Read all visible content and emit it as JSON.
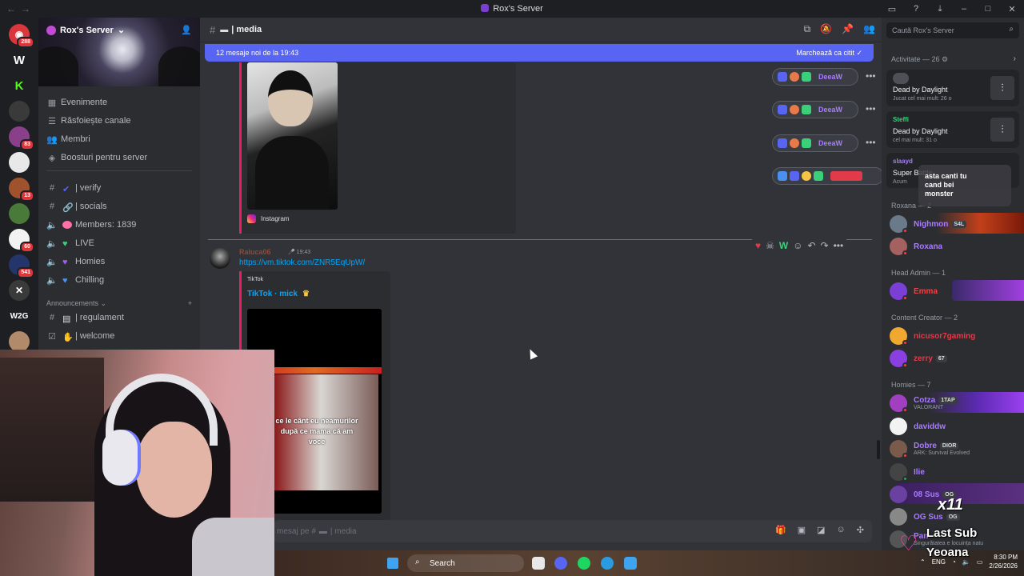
{
  "window": {
    "title": "Rox's Server"
  },
  "rail": {
    "badges": [
      "288",
      "83",
      "13",
      "60",
      "541"
    ]
  },
  "sidebar": {
    "server_name": "Rox's Server",
    "items": [
      {
        "label": "Evenimente"
      },
      {
        "label": "Răsfoiește canale"
      },
      {
        "label": "Membri"
      },
      {
        "label": "Boosturi pentru server"
      }
    ],
    "channels": [
      {
        "label": "| verify"
      },
      {
        "label": "| socials"
      },
      {
        "label": "Members: 1839"
      },
      {
        "label": "LIVE"
      },
      {
        "label": "Homies"
      },
      {
        "label": "Chilling"
      }
    ],
    "category": "Announcements",
    "announce_channels": [
      {
        "label": "| regulament"
      },
      {
        "label": "| welcome"
      }
    ]
  },
  "chat": {
    "channel_name": "| media",
    "new_messages_text": "12 mesaje noi de la 19:43",
    "mark_read": "Marchează ca citit",
    "embed1": {
      "source": "Instagram"
    },
    "reactions": [
      {
        "name": "DeeaW"
      },
      {
        "name": "DeeaW"
      },
      {
        "name": "DeeaW"
      }
    ],
    "message": {
      "author": "Raluca06",
      "time": "19:43",
      "link": "https://vm.tiktok.com/ZNR5EqUpW/",
      "embed_provider": "TikTok",
      "embed_title": "TikTok · mick",
      "video_caption": "ce le cânt eu neamurilor după ce mama că am voce"
    },
    "composer_placeholder": "mesaj pe #",
    "composer_channel": "| media"
  },
  "right": {
    "search_placeholder": "Caută Rox's Server",
    "activity_header": "Activitate — 26",
    "activities": [
      {
        "game": "Dead by Daylight",
        "hours": "Jucat cel mai mult: 26 o"
      },
      {
        "who": "Steffi",
        "game": "Dead by Daylight",
        "hours": "cel mai mult: 31 o"
      },
      {
        "who": "slaayd",
        "game": "Super Battle",
        "hours": "Acum"
      }
    ],
    "sticker_text": "asta canti tu cand bei monster",
    "groups": [
      {
        "header": "Roxana — 2",
        "members": [
          {
            "name": "Nighmon",
            "tag": "S4L"
          },
          {
            "name": "Roxana"
          }
        ]
      },
      {
        "header": "Head Admin — 1",
        "members": [
          {
            "name": "Emma"
          }
        ]
      },
      {
        "header": "Content Creator — 2",
        "members": [
          {
            "name": "nicusor7gaming"
          },
          {
            "name": "zerry",
            "tag": "67"
          }
        ]
      },
      {
        "header": "Homies — 7",
        "members": [
          {
            "name": "Cotza",
            "tag": "1TAP",
            "sub": "VALORANT"
          },
          {
            "name": "daviddw"
          },
          {
            "name": "Dobre",
            "tag": "DIOR",
            "sub": "ARK: Survival Evolved"
          },
          {
            "name": "Ilie"
          },
          {
            "name": "08 Sus",
            "tag": "OG"
          },
          {
            "name": "OG Sus",
            "tag": "OG"
          },
          {
            "name": "Pan",
            "sub": "Singurătatea e locuința natu"
          }
        ]
      }
    ]
  },
  "overlay": {
    "sub_line1": "Last Sub",
    "sub_line2": "Yeoana",
    "multiplier": "x11"
  },
  "taskbar": {
    "search": "Search",
    "lang": "ENG",
    "time": "8:30 PM",
    "date": "2/26/2026"
  }
}
